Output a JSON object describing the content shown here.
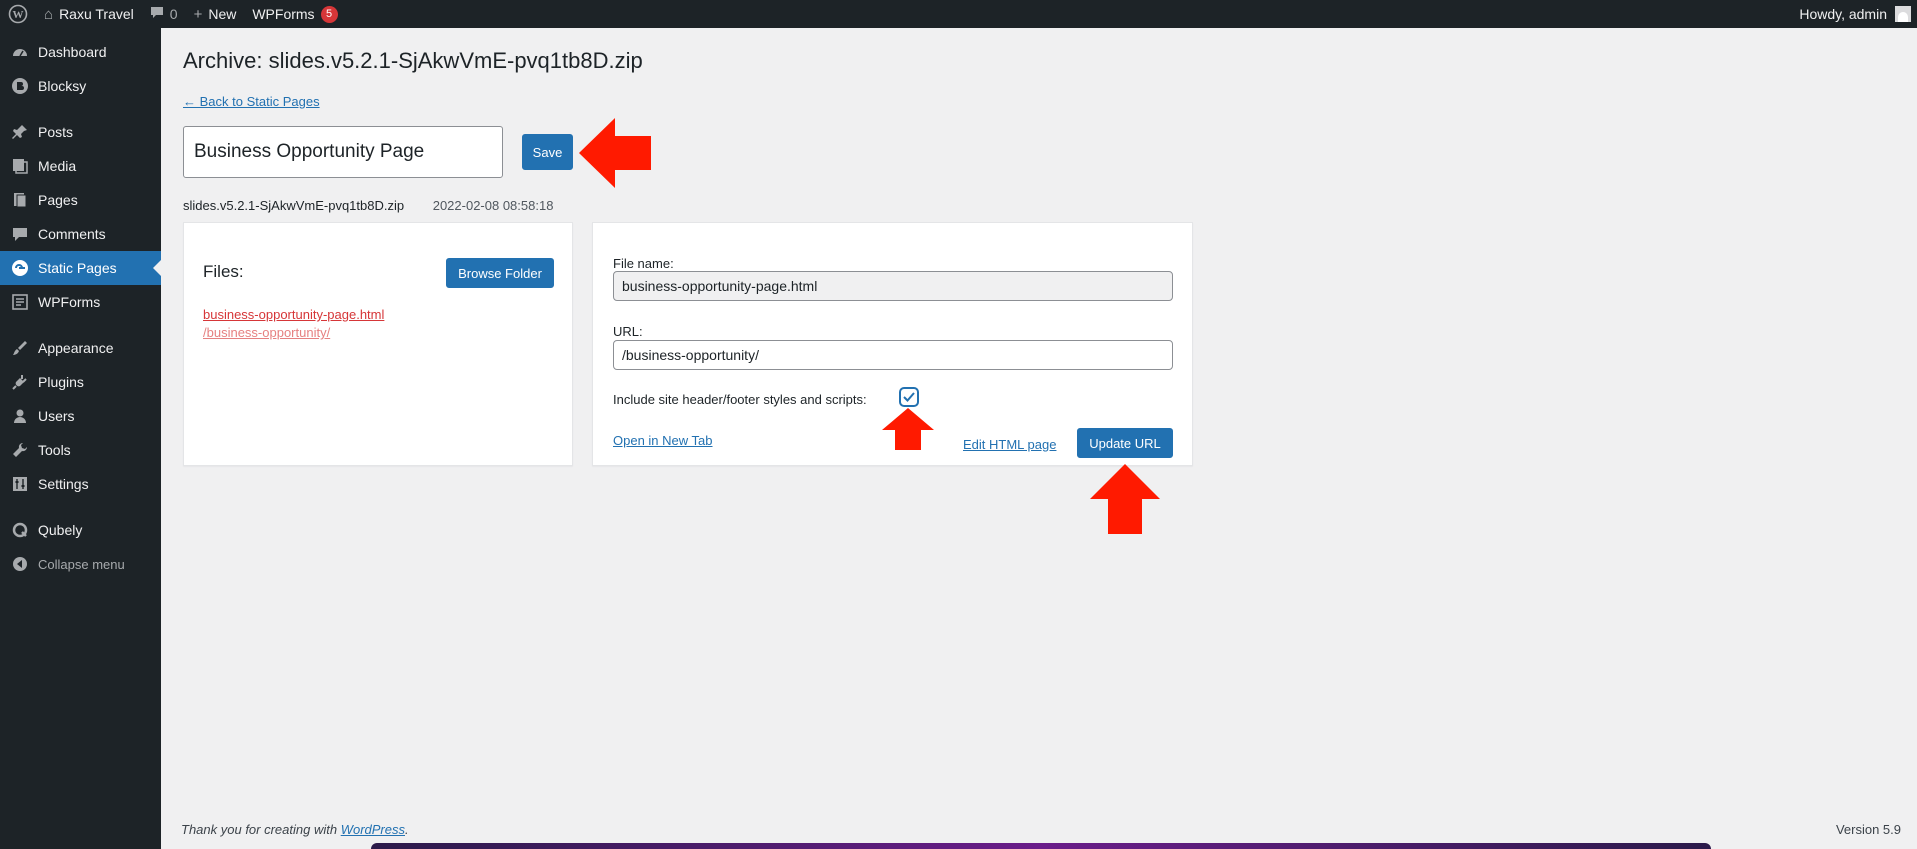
{
  "adminbar": {
    "site_name": "Raxu Travel",
    "comments_count": "0",
    "new_label": "New",
    "wpforms_label": "WPForms",
    "wpforms_badge": "5",
    "howdy": "Howdy, admin"
  },
  "sidebar": {
    "items": [
      {
        "label": "Dashboard",
        "icon": "dashboard-icon"
      },
      {
        "label": "Blocksy",
        "icon": "blocksy-icon"
      },
      {
        "label": "Posts",
        "icon": "pin-icon"
      },
      {
        "label": "Media",
        "icon": "media-icon"
      },
      {
        "label": "Pages",
        "icon": "pages-icon"
      },
      {
        "label": "Comments",
        "icon": "comments-icon"
      },
      {
        "label": "Static Pages",
        "icon": "static-pages-icon"
      },
      {
        "label": "WPForms",
        "icon": "wpforms-icon"
      },
      {
        "label": "Appearance",
        "icon": "brush-icon"
      },
      {
        "label": "Plugins",
        "icon": "plugin-icon"
      },
      {
        "label": "Users",
        "icon": "user-icon"
      },
      {
        "label": "Tools",
        "icon": "wrench-icon"
      },
      {
        "label": "Settings",
        "icon": "settings-icon"
      },
      {
        "label": "Qubely",
        "icon": "qubely-icon"
      },
      {
        "label": "Collapse menu",
        "icon": "collapse-icon"
      }
    ],
    "current": "Static Pages"
  },
  "main": {
    "title": "Archive: slides.v5.2.1-SjAkwVmE-pvq1tb8D.zip",
    "back_link": "← Back to Static Pages",
    "page_name_value": "Business Opportunity Page",
    "save_label": "Save",
    "archive_filename": "slides.v5.2.1-SjAkwVmE-pvq1tb8D.zip",
    "archive_date": "2022-02-08 08:58:18",
    "files": {
      "title": "Files:",
      "browse_label": "Browse Folder",
      "file_link": "business-opportunity-page.html",
      "file_path": "/business-opportunity/"
    },
    "details": {
      "file_name_label": "File name:",
      "file_name_value": "business-opportunity-page.html",
      "url_label": "URL:",
      "url_value": "/business-opportunity/",
      "include_label": "Include site header/footer styles and scripts:",
      "include_checked": true,
      "open_new_tab": "Open in New Tab",
      "edit_html": "Edit HTML page",
      "update_label": "Update URL"
    }
  },
  "footer": {
    "thanks_prefix": "Thank you for creating with ",
    "wordpress_link": "WordPress",
    "thanks_suffix": ".",
    "version": "Version 5.9"
  },
  "colors": {
    "accent": "#2271b1",
    "annotation_arrow": "#ff1a00",
    "sidebar_bg": "#1d2327"
  }
}
